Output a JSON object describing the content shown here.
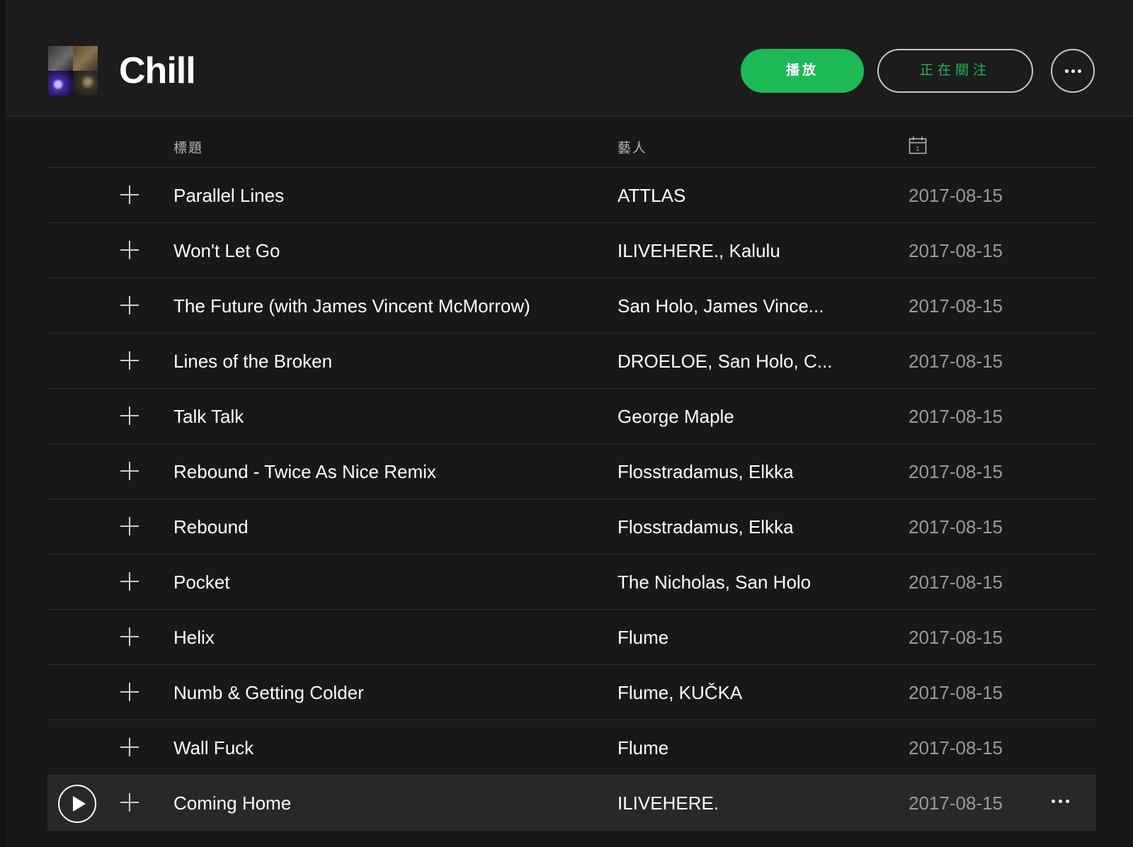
{
  "header": {
    "title": "Chill",
    "play_label": "播放",
    "follow_label": "正在關注",
    "more_icon": "more-horizontal-icon",
    "cover_icon": "playlist-cover-mosaic"
  },
  "columns": {
    "title": "標題",
    "artist": "藝人",
    "date_icon": "calendar-icon"
  },
  "tracks": [
    {
      "title": "Parallel Lines",
      "artist": "ATTLAS",
      "date": "2017-08-15"
    },
    {
      "title": "Won't Let Go",
      "artist": "ILIVEHERE., Kalulu",
      "date": "2017-08-15"
    },
    {
      "title": "The Future (with James Vincent McMorrow)",
      "artist": "San Holo, James Vince...",
      "date": "2017-08-15"
    },
    {
      "title": "Lines of the Broken",
      "artist": "DROELOE, San Holo, C...",
      "date": "2017-08-15"
    },
    {
      "title": "Talk Talk",
      "artist": "George Maple",
      "date": "2017-08-15"
    },
    {
      "title": "Rebound - Twice As Nice Remix",
      "artist": "Flosstradamus, Elkka",
      "date": "2017-08-15"
    },
    {
      "title": "Rebound",
      "artist": "Flosstradamus, Elkka",
      "date": "2017-08-15"
    },
    {
      "title": "Pocket",
      "artist": "The Nicholas, San Holo",
      "date": "2017-08-15"
    },
    {
      "title": "Helix",
      "artist": "Flume",
      "date": "2017-08-15"
    },
    {
      "title": "Numb & Getting Colder",
      "artist": "Flume, KUČKA",
      "date": "2017-08-15"
    },
    {
      "title": "Wall Fuck",
      "artist": "Flume",
      "date": "2017-08-15"
    },
    {
      "title": "Coming Home",
      "artist": "ILIVEHERE.",
      "date": "2017-08-15",
      "hovered": true
    }
  ],
  "colors": {
    "accent": "#1db954",
    "background": "#181818",
    "row_hover": "#282828",
    "date_text": "#9a9a9a"
  }
}
